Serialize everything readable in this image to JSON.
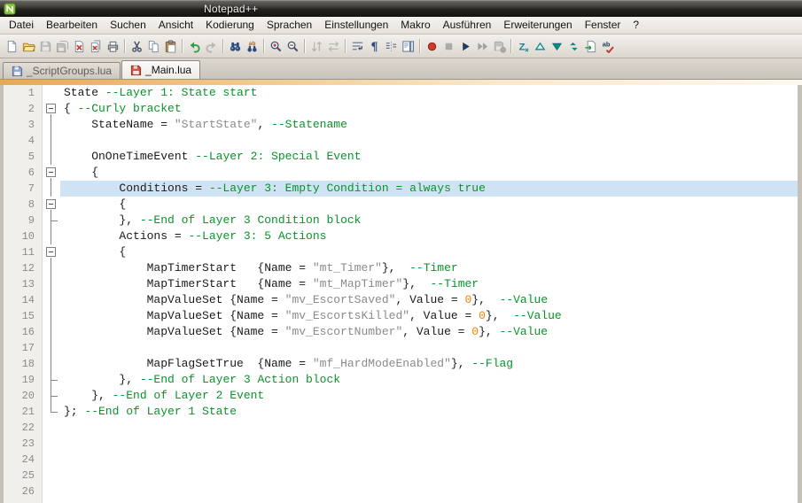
{
  "window": {
    "title": "Notepad++"
  },
  "menu": {
    "items": [
      "Datei",
      "Bearbeiten",
      "Suchen",
      "Ansicht",
      "Kodierung",
      "Sprachen",
      "Einstellungen",
      "Makro",
      "Ausführen",
      "Erweiterungen",
      "Fenster",
      "?"
    ]
  },
  "toolbar": {
    "buttons": [
      {
        "name": "new-file",
        "disabled": false
      },
      {
        "name": "open-file",
        "disabled": false
      },
      {
        "name": "save-file",
        "disabled": true
      },
      {
        "name": "save-all",
        "disabled": true
      },
      {
        "name": "close-file",
        "disabled": false
      },
      {
        "name": "close-all",
        "disabled": false
      },
      {
        "name": "print",
        "disabled": false
      },
      {
        "sep": true
      },
      {
        "name": "cut",
        "disabled": false
      },
      {
        "name": "copy",
        "disabled": false
      },
      {
        "name": "paste",
        "disabled": false
      },
      {
        "sep": true
      },
      {
        "name": "undo",
        "disabled": false
      },
      {
        "name": "redo",
        "disabled": true
      },
      {
        "sep": true
      },
      {
        "name": "find",
        "disabled": false
      },
      {
        "name": "replace",
        "disabled": false
      },
      {
        "sep": true
      },
      {
        "name": "zoom-in",
        "disabled": false
      },
      {
        "name": "zoom-out",
        "disabled": false
      },
      {
        "sep": true
      },
      {
        "name": "sync-scroll-vertical",
        "disabled": true
      },
      {
        "name": "sync-scroll-horizontal",
        "disabled": true
      },
      {
        "sep": true
      },
      {
        "name": "word-wrap",
        "disabled": false
      },
      {
        "name": "show-all-characters",
        "disabled": false
      },
      {
        "name": "indent-guide",
        "disabled": false
      },
      {
        "name": "document-map",
        "disabled": false
      },
      {
        "sep": true
      },
      {
        "name": "record-macro",
        "disabled": false
      },
      {
        "name": "stop-recording",
        "disabled": true
      },
      {
        "name": "play-macro",
        "disabled": false
      },
      {
        "name": "run-macro-multiple",
        "disabled": true
      },
      {
        "name": "save-macro",
        "disabled": true
      },
      {
        "sep": true
      },
      {
        "name": "textfx",
        "disabled": false
      },
      {
        "name": "fold-all",
        "disabled": false
      },
      {
        "name": "unfold-all",
        "disabled": false
      },
      {
        "name": "compare",
        "disabled": false
      },
      {
        "name": "export",
        "disabled": false
      },
      {
        "name": "spell-check",
        "disabled": false
      }
    ]
  },
  "tabs": [
    {
      "label": "_ScriptGroups.lua",
      "active": false,
      "modified": false
    },
    {
      "label": "_Main.lua",
      "active": true,
      "modified": true
    }
  ],
  "editor": {
    "current_line": 7,
    "colors": {
      "default": "#1a1a1a",
      "comment": "#089428",
      "string": "#8a8a8a",
      "number": "#ff8000",
      "current_line_bg": "#cfe3f4"
    },
    "lines": [
      {
        "num": 1,
        "fold": "none",
        "segments": [
          [
            "State ",
            "default"
          ],
          [
            "--Layer 1: State start",
            "comment"
          ]
        ]
      },
      {
        "num": 2,
        "fold": "box",
        "segments": [
          [
            "{ ",
            "default"
          ],
          [
            "--Curly bracket",
            "comment"
          ]
        ]
      },
      {
        "num": 3,
        "fold": "line",
        "segments": [
          [
            "    StateName = ",
            "default"
          ],
          [
            "\"StartState\"",
            "string"
          ],
          [
            ", ",
            "default"
          ],
          [
            "--Statename",
            "comment"
          ]
        ]
      },
      {
        "num": 4,
        "fold": "line",
        "segments": []
      },
      {
        "num": 5,
        "fold": "line",
        "segments": [
          [
            "    OnOneTimeEvent ",
            "default"
          ],
          [
            "--Layer 2: Special Event",
            "comment"
          ]
        ]
      },
      {
        "num": 6,
        "fold": "box",
        "segments": [
          [
            "    {",
            "default"
          ]
        ]
      },
      {
        "num": 7,
        "fold": "line",
        "segments": [
          [
            "        Conditions = ",
            "default"
          ],
          [
            "--Layer 3: Empty Condition = always true",
            "comment"
          ]
        ]
      },
      {
        "num": 8,
        "fold": "box",
        "segments": [
          [
            "        {",
            "default"
          ]
        ]
      },
      {
        "num": 9,
        "fold": "tcorner",
        "segments": [
          [
            "        }, ",
            "default"
          ],
          [
            "--End of Layer 3 Condition block",
            "comment"
          ]
        ]
      },
      {
        "num": 10,
        "fold": "line",
        "segments": [
          [
            "        Actions = ",
            "default"
          ],
          [
            "--Layer 3: 5 Actions",
            "comment"
          ]
        ]
      },
      {
        "num": 11,
        "fold": "box",
        "segments": [
          [
            "        {",
            "default"
          ]
        ]
      },
      {
        "num": 12,
        "fold": "line",
        "segments": [
          [
            "            MapTimerStart   {Name = ",
            "default"
          ],
          [
            "\"mt_Timer\"",
            "string"
          ],
          [
            "},  ",
            "default"
          ],
          [
            "--Timer",
            "comment"
          ]
        ]
      },
      {
        "num": 13,
        "fold": "line",
        "segments": [
          [
            "            MapTimerStart   {Name = ",
            "default"
          ],
          [
            "\"mt_MapTimer\"",
            "string"
          ],
          [
            "},  ",
            "default"
          ],
          [
            "--Timer",
            "comment"
          ]
        ]
      },
      {
        "num": 14,
        "fold": "line",
        "segments": [
          [
            "            MapValueSet {Name = ",
            "default"
          ],
          [
            "\"mv_EscortSaved\"",
            "string"
          ],
          [
            ", Value = ",
            "default"
          ],
          [
            "0",
            "number"
          ],
          [
            "},  ",
            "default"
          ],
          [
            "--Value",
            "comment"
          ]
        ]
      },
      {
        "num": 15,
        "fold": "line",
        "segments": [
          [
            "            MapValueSet {Name = ",
            "default"
          ],
          [
            "\"mv_EscortsKilled\"",
            "string"
          ],
          [
            ", Value = ",
            "default"
          ],
          [
            "0",
            "number"
          ],
          [
            "},  ",
            "default"
          ],
          [
            "--Value",
            "comment"
          ]
        ]
      },
      {
        "num": 16,
        "fold": "line",
        "segments": [
          [
            "            MapValueSet {Name = ",
            "default"
          ],
          [
            "\"mv_EscortNumber\"",
            "string"
          ],
          [
            ", Value = ",
            "default"
          ],
          [
            "0",
            "number"
          ],
          [
            "}, ",
            "default"
          ],
          [
            "--Value",
            "comment"
          ]
        ]
      },
      {
        "num": 17,
        "fold": "line",
        "segments": []
      },
      {
        "num": 18,
        "fold": "line",
        "segments": [
          [
            "            MapFlagSetTrue  {Name = ",
            "default"
          ],
          [
            "\"mf_HardModeEnabled\"",
            "string"
          ],
          [
            "}, ",
            "default"
          ],
          [
            "--Flag",
            "comment"
          ]
        ]
      },
      {
        "num": 19,
        "fold": "tcorner",
        "segments": [
          [
            "        }, ",
            "default"
          ],
          [
            "--End of Layer 3 Action block",
            "comment"
          ]
        ]
      },
      {
        "num": 20,
        "fold": "tcorner",
        "segments": [
          [
            "    }, ",
            "default"
          ],
          [
            "--End of Layer 2 Event",
            "comment"
          ]
        ]
      },
      {
        "num": 21,
        "fold": "lcorner",
        "segments": [
          [
            "}; ",
            "default"
          ],
          [
            "--End of Layer 1 State",
            "comment"
          ]
        ]
      },
      {
        "num": 22,
        "fold": "none",
        "segments": []
      },
      {
        "num": 23,
        "fold": "none",
        "segments": []
      },
      {
        "num": 24,
        "fold": "none",
        "segments": []
      },
      {
        "num": 25,
        "fold": "none",
        "segments": []
      },
      {
        "num": 26,
        "fold": "none",
        "segments": []
      }
    ]
  }
}
